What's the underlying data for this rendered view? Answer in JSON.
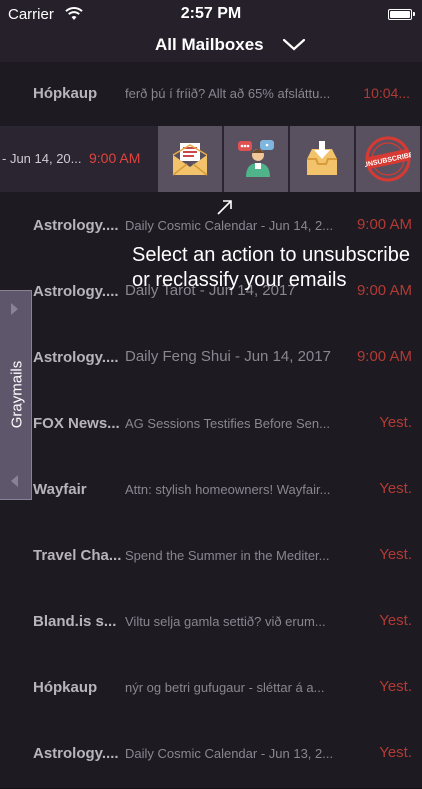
{
  "status_bar": {
    "carrier": "Carrier",
    "time": "2:57 PM",
    "wifi_icon": "wifi-icon",
    "battery_icon": "battery-icon"
  },
  "nav": {
    "title": "All Mailboxes",
    "dropdown_icon": "chevron-down-icon"
  },
  "emails": [
    {
      "sender": "Hópkaup",
      "subject": "ferð þú í fríið? Allt að 65% afsláttu...",
      "date": "10:04..."
    },
    {
      "sender": "",
      "subject": "",
      "date": ""
    },
    {
      "sender": "Astrology....",
      "subject": "Daily Cosmic Calendar - Jun 14, 2...",
      "date": "9:00 AM"
    },
    {
      "sender": "Astrology....",
      "subject": "Daily Tarot - Jun 14, 2017",
      "date": "9:00 AM"
    },
    {
      "sender": "Astrology....",
      "subject": "Daily Feng Shui - Jun 14, 2017",
      "date": "9:00 AM"
    },
    {
      "sender": "FOX News...",
      "subject": "AG Sessions Testifies Before Sen...",
      "date": "Yest."
    },
    {
      "sender": "Wayfair",
      "subject": "Attn: stylish homeowners! Wayfair...",
      "date": "Yest."
    },
    {
      "sender": "Travel Cha...",
      "subject": "Spend the Summer in the Mediter...",
      "date": "Yest."
    },
    {
      "sender": "Bland.is s...",
      "subject": "Viltu selja gamla settið? við erum...",
      "date": "Yest."
    },
    {
      "sender": "Hópkaup",
      "subject": "nýr og betri gufugaur - sléttar á a...",
      "date": "Yest."
    },
    {
      "sender": "Astrology....",
      "subject": "Daily Cosmic Calendar - Jun 13, 2...",
      "date": "Yest."
    }
  ],
  "swiped_row": {
    "subject": "- Jun 14, 20...",
    "date": "9:00 AM",
    "actions": [
      {
        "name": "mark-read",
        "icon": "open-envelope-icon"
      },
      {
        "name": "sender-contact",
        "icon": "people-chat-icon"
      },
      {
        "name": "move-to-inbox",
        "icon": "inbox-download-icon"
      },
      {
        "name": "unsubscribe",
        "icon": "unsubscribe-stamp-icon",
        "label": "UNSUBSCRIBE"
      }
    ]
  },
  "hint": "Select an action to unsubscribe or reclassify your emails",
  "side_tab": {
    "label": "Graymails"
  },
  "colors": {
    "background": "#1e1a22",
    "date_red": "#b23a34",
    "side_tab": "#5e566a"
  }
}
